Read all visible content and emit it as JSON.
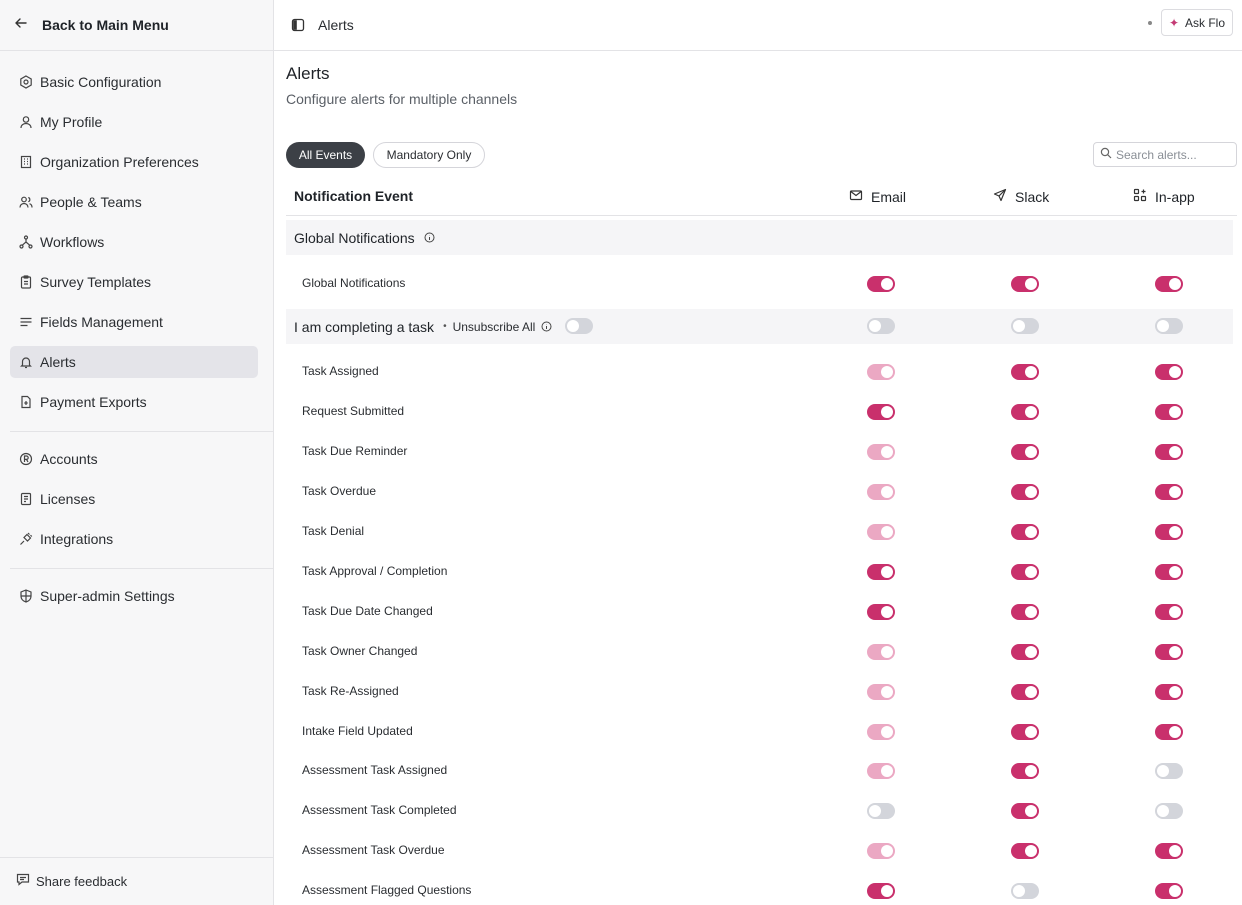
{
  "sidebar": {
    "back_label": "Back to Main Menu",
    "group1": [
      {
        "label": "Basic Configuration",
        "icon": "settings-hex-icon"
      },
      {
        "label": "My Profile",
        "icon": "user-icon"
      },
      {
        "label": "Organization Preferences",
        "icon": "building-icon"
      },
      {
        "label": "People & Teams",
        "icon": "users-icon"
      },
      {
        "label": "Workflows",
        "icon": "workflow-icon"
      },
      {
        "label": "Survey Templates",
        "icon": "clipboard-icon"
      },
      {
        "label": "Fields Management",
        "icon": "list-icon"
      },
      {
        "label": "Alerts",
        "icon": "bell-icon",
        "active": true
      },
      {
        "label": "Payment Exports",
        "icon": "file-export-icon"
      }
    ],
    "group2": [
      {
        "label": "Accounts",
        "icon": "account-circle-icon"
      },
      {
        "label": "Licenses",
        "icon": "license-icon"
      },
      {
        "label": "Integrations",
        "icon": "plug-icon"
      }
    ],
    "group3": [
      {
        "label": "Super-admin Settings",
        "icon": "shield-icon"
      }
    ],
    "feedback_label": "Share feedback"
  },
  "topbar": {
    "title": "Alerts",
    "ask_label": "Ask Flo"
  },
  "page": {
    "title": "Alerts",
    "subtitle": "Configure alerts for multiple channels"
  },
  "filters": {
    "all": "All Events",
    "mandatory": "Mandatory Only"
  },
  "search": {
    "placeholder": "Search alerts..."
  },
  "table": {
    "event_header": "Notification Event",
    "channels": [
      "Email",
      "Slack",
      "In-app"
    ],
    "sections": [
      {
        "name": "Global Notifications",
        "rows": [
          {
            "label": "Global Notifications",
            "states": [
              "on",
              "on",
              "on"
            ]
          }
        ]
      },
      {
        "name": "I am completing a task",
        "unsubscribe_label": "Unsubscribe All",
        "unsubscribe_state": "off",
        "header_states": [
          "off",
          "off",
          "off"
        ],
        "rows": [
          {
            "label": "Task Assigned",
            "states": [
              "dim",
              "on",
              "on"
            ]
          },
          {
            "label": "Request Submitted",
            "states": [
              "on",
              "on",
              "on"
            ]
          },
          {
            "label": "Task Due Reminder",
            "states": [
              "dim",
              "on",
              "on"
            ]
          },
          {
            "label": "Task Overdue",
            "states": [
              "dim",
              "on",
              "on"
            ]
          },
          {
            "label": "Task Denial",
            "states": [
              "dim",
              "on",
              "on"
            ]
          },
          {
            "label": "Task Approval / Completion",
            "states": [
              "on",
              "on",
              "on"
            ]
          },
          {
            "label": "Task Due Date Changed",
            "states": [
              "on",
              "on",
              "on"
            ]
          },
          {
            "label": "Task Owner Changed",
            "states": [
              "dim",
              "on",
              "on"
            ]
          },
          {
            "label": "Task Re-Assigned",
            "states": [
              "dim",
              "on",
              "on"
            ]
          },
          {
            "label": "Intake Field Updated",
            "states": [
              "dim",
              "on",
              "on"
            ]
          },
          {
            "label": "Assessment Task Assigned",
            "states": [
              "dim",
              "on",
              "off"
            ]
          },
          {
            "label": "Assessment Task Completed",
            "states": [
              "off",
              "on",
              "off"
            ]
          },
          {
            "label": "Assessment Task Overdue",
            "states": [
              "dim",
              "on",
              "on"
            ]
          },
          {
            "label": "Assessment Flagged Questions",
            "states": [
              "on",
              "off",
              "on"
            ]
          }
        ]
      }
    ]
  }
}
